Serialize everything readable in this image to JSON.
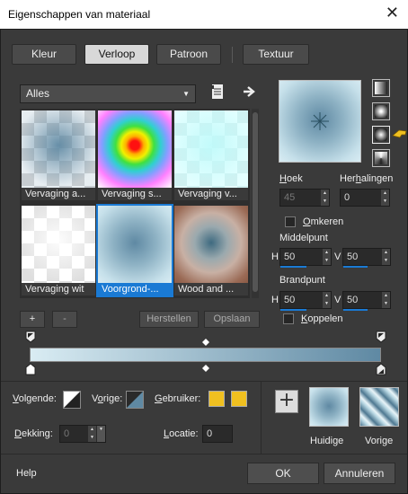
{
  "window": {
    "title": "Eigenschappen van materiaal",
    "close_glyph": "✕"
  },
  "tabs": [
    {
      "label": "Kleur"
    },
    {
      "label": "Verloop"
    },
    {
      "label": "Patroon"
    },
    {
      "label": "Textuur"
    }
  ],
  "category": {
    "selected": "Alles"
  },
  "gallery": {
    "items": [
      {
        "label": "Vervaging a..."
      },
      {
        "label": "Vervaging s..."
      },
      {
        "label": "Vervaging v..."
      },
      {
        "label": "Vervaging wit"
      },
      {
        "label": "Voorgrond-..."
      },
      {
        "label": "Wood and ..."
      }
    ]
  },
  "gallery_buttons": {
    "add": "+",
    "remove": "-",
    "restore": "Herstellen",
    "save": "Opslaan"
  },
  "settings": {
    "angle_label": "Hoek",
    "angle_value": "45",
    "repeats_label": "Herhalingen",
    "repeats_value": "0",
    "invert_label": "Omkeren",
    "center_label": "Middelpunt",
    "center_h_label": "H",
    "center_h": "50",
    "center_v_label": "V",
    "center_v": "50",
    "focal_label": "Brandpunt",
    "focal_h_label": "H",
    "focal_h": "50",
    "focal_v_label": "V",
    "focal_v": "50",
    "link_label": "Koppelen"
  },
  "stops": {
    "next_label": "Volgende:",
    "prev_label": "Vorige:",
    "user_label": "Gebruiker:",
    "opacity_label": "Dekking:",
    "opacity_value": "0",
    "location_label": "Locatie:",
    "location_value": "0"
  },
  "swatches": {
    "current_label": "Huidige",
    "previous_label": "Vorige",
    "add_glyph": "+"
  },
  "footer": {
    "help": "Help",
    "ok": "OK",
    "cancel": "Annuleren"
  },
  "colors": {
    "accent": "#1a7ad4",
    "user_swatch": "#f0c020",
    "gradient_dark": "#5f89a3",
    "gradient_light": "#d9ecf3"
  }
}
